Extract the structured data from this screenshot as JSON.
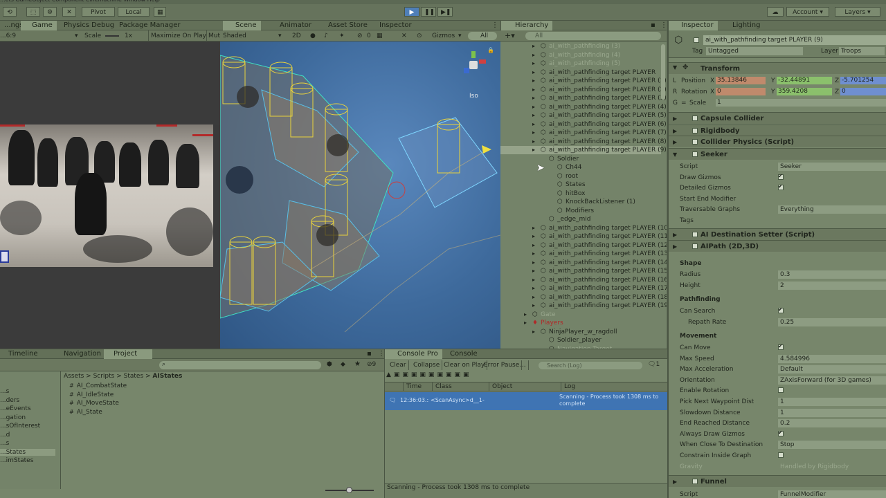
{
  "menubar": {
    "items": [
      "...ets",
      "GameObject",
      "Component",
      "Cinemachine",
      "Window",
      "Help"
    ]
  },
  "toolbar": {
    "pivot": "Pivot",
    "local": "Local",
    "account": "Account",
    "layers": "Layers"
  },
  "game": {
    "tabs": [
      "...ngs",
      "Game",
      "Physics Debug",
      "Package Manager"
    ],
    "aspect": "...6:9",
    "scale_label": "Scale",
    "scale_value": "1x",
    "maximize": "Maximize On Play",
    "mute": "Mut..."
  },
  "scene": {
    "tabs": [
      "Scene",
      "Animator",
      "Asset Store",
      "Inspector"
    ],
    "shading": "Shaded",
    "mode2d": "2D",
    "gizmos": "Gizmos",
    "search": "All",
    "gizmo_count": "0",
    "iso": "Iso"
  },
  "hierarchy": {
    "tab": "Hierarchy",
    "search": "All",
    "rows": [
      {
        "text": "ai_with_pathfinding (3)",
        "d": 0,
        "dim": true
      },
      {
        "text": "ai_with_pathfinding (4)",
        "d": 0,
        "dim": true
      },
      {
        "text": "ai_with_pathfinding (5)",
        "d": 0,
        "dim": true
      },
      {
        "text": "ai_with_pathfinding target PLAYER",
        "d": 0
      },
      {
        "text": "ai_with_pathfinding target PLAYER (1)",
        "d": 0
      },
      {
        "text": "ai_with_pathfinding target PLAYER (2)",
        "d": 0
      },
      {
        "text": "ai_with_pathfinding target PLAYER (3)",
        "d": 0
      },
      {
        "text": "ai_with_pathfinding target PLAYER (4)",
        "d": 0
      },
      {
        "text": "ai_with_pathfinding target PLAYER (5)",
        "d": 0
      },
      {
        "text": "ai_with_pathfinding target PLAYER (6)",
        "d": 0
      },
      {
        "text": "ai_with_pathfinding target PLAYER (7)",
        "d": 0
      },
      {
        "text": "ai_with_pathfinding target PLAYER (8)",
        "d": 0
      },
      {
        "text": "ai_with_pathfinding target PLAYER (9)",
        "d": 0,
        "sel": true
      },
      {
        "text": "Soldier",
        "d": 1
      },
      {
        "text": "Ch44",
        "d": 2
      },
      {
        "text": "root",
        "d": 2
      },
      {
        "text": "States",
        "d": 2
      },
      {
        "text": "hitBox",
        "d": 2
      },
      {
        "text": "KnockBackListener (1)",
        "d": 2
      },
      {
        "text": "Modifiers",
        "d": 2
      },
      {
        "text": "_edge_mid",
        "d": 1
      },
      {
        "text": "ai_with_pathfinding target PLAYER (10",
        "d": 0
      },
      {
        "text": "ai_with_pathfinding target PLAYER (11",
        "d": 0
      },
      {
        "text": "ai_with_pathfinding target PLAYER (12",
        "d": 0
      },
      {
        "text": "ai_with_pathfinding target PLAYER (13",
        "d": 0
      },
      {
        "text": "ai_with_pathfinding target PLAYER (14",
        "d": 0
      },
      {
        "text": "ai_with_pathfinding target PLAYER (15",
        "d": 0
      },
      {
        "text": "ai_with_pathfinding target PLAYER (16",
        "d": 0
      },
      {
        "text": "ai_with_pathfinding target PLAYER (17",
        "d": 0
      },
      {
        "text": "ai_with_pathfinding target PLAYER (18",
        "d": 0
      },
      {
        "text": "ai_with_pathfinding target PLAYER (19",
        "d": 0
      },
      {
        "text": "Gate",
        "d": -1,
        "dim": true
      },
      {
        "text": "Players",
        "d": -1,
        "red": true
      },
      {
        "text": "NinjaPlayer_w_ragdoll",
        "d": 0
      },
      {
        "text": "Soldier_player",
        "d": 1
      },
      {
        "text": "Navigation Target",
        "d": 1,
        "dim": true
      }
    ]
  },
  "inspector": {
    "tabs": [
      "Inspector",
      "Lighting"
    ],
    "object_name": "ai_with_pathfinding target PLAYER (9)",
    "tag_label": "Tag",
    "tag": "Untagged",
    "layer_label": "Layer",
    "layer": "Troops",
    "transform": {
      "title": "Transform",
      "position_label": "Position",
      "rotation_label": "Rotation",
      "scale_label": "Scale",
      "px": "35.13846",
      "py": "-32.44891",
      "pz": "-5.701254",
      "rx": "0",
      "ry": "359.4208",
      "rz": "0",
      "scale": "1",
      "L": "L",
      "R": "R",
      "G": "G",
      "X": "X",
      "Y": "Y",
      "Z": "Z"
    },
    "components": [
      "Capsule Collider",
      "Rigidbody",
      "Collider Physics (Script)",
      "Seeker"
    ],
    "seeker": [
      {
        "label": "Script",
        "value": "Seeker"
      },
      {
        "label": "Draw Gizmos",
        "check": true
      },
      {
        "label": "Detailed Gizmos",
        "check": true
      },
      {
        "label": "Start End Modifier",
        "value": ""
      },
      {
        "label": "Traversable Graphs",
        "value": "Everything"
      },
      {
        "label": "Tags",
        "value": ""
      }
    ],
    "ai_dest": "AI Destination Setter (Script)",
    "aipath": "AIPath (2D,3D)",
    "shape": "Shape",
    "shape_rows": [
      {
        "label": "Radius",
        "value": "0.3"
      },
      {
        "label": "Height",
        "value": "2"
      }
    ],
    "pathfinding": "Pathfinding",
    "path_rows": [
      {
        "label": "Can Search",
        "check": true
      },
      {
        "label": "Repath Rate",
        "value": "0.25"
      }
    ],
    "movement": "Movement",
    "move_rows": [
      {
        "label": "Can Move",
        "check": true
      },
      {
        "label": "Max Speed",
        "value": "4.584996"
      },
      {
        "label": "Max Acceleration",
        "value": "Default"
      },
      {
        "label": "Orientation",
        "value": "ZAxisForward (for 3D games)"
      },
      {
        "label": "Enable Rotation",
        "check": false
      },
      {
        "label": "Pick Next Waypoint Dist",
        "value": "1"
      },
      {
        "label": "Slowdown Distance",
        "value": "1"
      },
      {
        "label": "End Reached Distance",
        "value": "0.2"
      },
      {
        "label": "Always Draw Gizmos",
        "check": true
      },
      {
        "label": "When Close To Destination",
        "value": "Stop"
      },
      {
        "label": "Constrain Inside Graph",
        "check": false
      },
      {
        "label": "Gravity",
        "value": "Handled by Rigidbody"
      }
    ],
    "funnel": "Funnel",
    "funnel_script": "Script",
    "funnel_value": "FunnelModifier"
  },
  "project": {
    "tabs": [
      "Timeline",
      "Navigation",
      "Project"
    ],
    "breadcrumb": [
      "Assets",
      "Scripts",
      "States",
      "AIStates"
    ],
    "files": [
      "AI_CombatState",
      "AI_IdleState",
      "AI_MoveState",
      "AI_State"
    ],
    "tree": [
      "...s",
      "...ders",
      "...eEvents",
      "...gation",
      "...sOfInterest",
      "...d",
      "...s",
      "...States",
      "...imStates"
    ],
    "count": "9"
  },
  "console": {
    "tabs": [
      "Console Pro",
      "Console"
    ],
    "buttons": [
      "Clear",
      "Collapse",
      "Clear on Play",
      "Error Pause",
      "..."
    ],
    "search": "Search (Log)",
    "cols": [
      "Time",
      "Class",
      "Object",
      "Log"
    ],
    "entry_time": "12:36:03.:",
    "entry_class": "<ScanAsync>d__1-",
    "entry_log": "Scanning - Process took 1308 ms to complete",
    "count": "1"
  },
  "status": "Scanning - Process took 1308 ms to complete"
}
